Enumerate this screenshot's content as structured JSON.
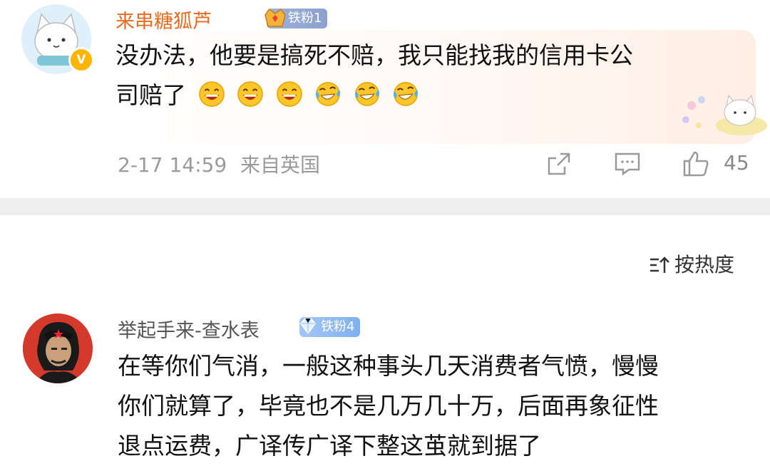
{
  "comment1": {
    "username": "来串糖狐芦",
    "fan_badge": "铁粉1",
    "text_line1": "没办法，他要是搞死不赔，我只能找我的信用卡公",
    "text_line2": "司赔了",
    "emojis": [
      "laugh-emoji",
      "laugh-emoji",
      "laugh-emoji",
      "cry-laugh-emoji",
      "cry-laugh-emoji",
      "cry-laugh-emoji"
    ],
    "time": "2-17 14:59",
    "location": "来自英国",
    "like_count": "45",
    "icons": {
      "repost": "share-icon",
      "comment": "comment-icon",
      "like": "thumbs-up-icon",
      "verify": "v-badge-icon"
    }
  },
  "sort": {
    "label": "按热度",
    "icon": "sort-icon"
  },
  "comment2": {
    "username": "举起手来-查水表",
    "fan_badge": "铁粉4",
    "text_line1": "在等你们气消，一般这种事头几天消费者气愤，慢慢",
    "text_line2": "你们就算了，毕竟也不是几万几十万，后面再象征性",
    "text_line3": "退点运费，广译传广译下整这茧就到据了"
  },
  "colors": {
    "username1": "#e86a1f",
    "username2": "#555555",
    "meta": "#9a9a9a",
    "divider": "#eeeeee"
  }
}
